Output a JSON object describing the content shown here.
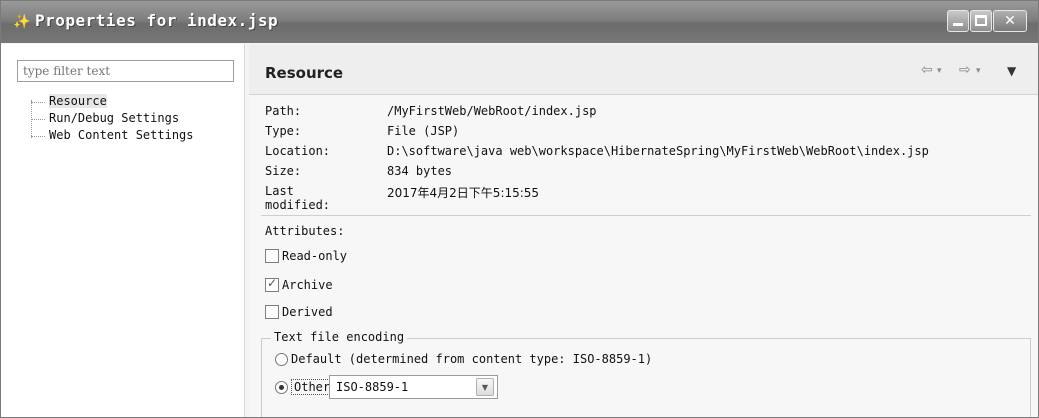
{
  "window": {
    "title": "Properties for index.jsp"
  },
  "left": {
    "filter_placeholder": "type filter text",
    "tree": [
      "Resource",
      "Run/Debug Settings",
      "Web Content Settings"
    ]
  },
  "header": {
    "title": "Resource",
    "back_icon": "⇦",
    "forward_icon": "⇨",
    "dropdown_icon": "▾",
    "menu_icon": "▼"
  },
  "info": {
    "path_label": "Path:",
    "path_value": "/MyFirstWeb/WebRoot/index.jsp",
    "type_label": "Type:",
    "type_value": "File  (JSP)",
    "location_label": "Location:",
    "location_value": "D:\\software\\java web\\workspace\\HibernateSpring\\MyFirstWeb\\WebRoot\\index.jsp",
    "size_label": "Size:",
    "size_value": "834  bytes",
    "modified_label": "Last modified:",
    "modified_value": "2017年4月2日下午5:15:55"
  },
  "attributes": {
    "title": "Attributes:",
    "read_only": "Read-only",
    "archive": "Archive",
    "derived": "Derived",
    "read_only_checked": false,
    "archive_checked": true,
    "derived_checked": false
  },
  "encoding": {
    "title": "Text file encoding",
    "default_label": "Default (determined from content type: ISO-8859-1)",
    "other_label": "Other:",
    "other_value": "ISO-8859-1",
    "selected": "Other"
  }
}
